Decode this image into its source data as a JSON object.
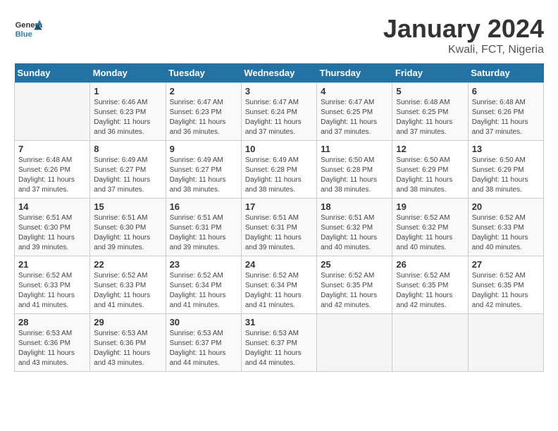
{
  "header": {
    "logo_general": "General",
    "logo_blue": "Blue",
    "month": "January 2024",
    "location": "Kwali, FCT, Nigeria"
  },
  "days_of_week": [
    "Sunday",
    "Monday",
    "Tuesday",
    "Wednesday",
    "Thursday",
    "Friday",
    "Saturday"
  ],
  "weeks": [
    [
      {
        "day": "",
        "info": ""
      },
      {
        "day": "1",
        "info": "Sunrise: 6:46 AM\nSunset: 6:23 PM\nDaylight: 11 hours\nand 36 minutes."
      },
      {
        "day": "2",
        "info": "Sunrise: 6:47 AM\nSunset: 6:23 PM\nDaylight: 11 hours\nand 36 minutes."
      },
      {
        "day": "3",
        "info": "Sunrise: 6:47 AM\nSunset: 6:24 PM\nDaylight: 11 hours\nand 37 minutes."
      },
      {
        "day": "4",
        "info": "Sunrise: 6:47 AM\nSunset: 6:25 PM\nDaylight: 11 hours\nand 37 minutes."
      },
      {
        "day": "5",
        "info": "Sunrise: 6:48 AM\nSunset: 6:25 PM\nDaylight: 11 hours\nand 37 minutes."
      },
      {
        "day": "6",
        "info": "Sunrise: 6:48 AM\nSunset: 6:26 PM\nDaylight: 11 hours\nand 37 minutes."
      }
    ],
    [
      {
        "day": "7",
        "info": "Sunrise: 6:48 AM\nSunset: 6:26 PM\nDaylight: 11 hours\nand 37 minutes."
      },
      {
        "day": "8",
        "info": "Sunrise: 6:49 AM\nSunset: 6:27 PM\nDaylight: 11 hours\nand 37 minutes."
      },
      {
        "day": "9",
        "info": "Sunrise: 6:49 AM\nSunset: 6:27 PM\nDaylight: 11 hours\nand 38 minutes."
      },
      {
        "day": "10",
        "info": "Sunrise: 6:49 AM\nSunset: 6:28 PM\nDaylight: 11 hours\nand 38 minutes."
      },
      {
        "day": "11",
        "info": "Sunrise: 6:50 AM\nSunset: 6:28 PM\nDaylight: 11 hours\nand 38 minutes."
      },
      {
        "day": "12",
        "info": "Sunrise: 6:50 AM\nSunset: 6:29 PM\nDaylight: 11 hours\nand 38 minutes."
      },
      {
        "day": "13",
        "info": "Sunrise: 6:50 AM\nSunset: 6:29 PM\nDaylight: 11 hours\nand 38 minutes."
      }
    ],
    [
      {
        "day": "14",
        "info": "Sunrise: 6:51 AM\nSunset: 6:30 PM\nDaylight: 11 hours\nand 39 minutes."
      },
      {
        "day": "15",
        "info": "Sunrise: 6:51 AM\nSunset: 6:30 PM\nDaylight: 11 hours\nand 39 minutes."
      },
      {
        "day": "16",
        "info": "Sunrise: 6:51 AM\nSunset: 6:31 PM\nDaylight: 11 hours\nand 39 minutes."
      },
      {
        "day": "17",
        "info": "Sunrise: 6:51 AM\nSunset: 6:31 PM\nDaylight: 11 hours\nand 39 minutes."
      },
      {
        "day": "18",
        "info": "Sunrise: 6:51 AM\nSunset: 6:32 PM\nDaylight: 11 hours\nand 40 minutes."
      },
      {
        "day": "19",
        "info": "Sunrise: 6:52 AM\nSunset: 6:32 PM\nDaylight: 11 hours\nand 40 minutes."
      },
      {
        "day": "20",
        "info": "Sunrise: 6:52 AM\nSunset: 6:33 PM\nDaylight: 11 hours\nand 40 minutes."
      }
    ],
    [
      {
        "day": "21",
        "info": "Sunrise: 6:52 AM\nSunset: 6:33 PM\nDaylight: 11 hours\nand 41 minutes."
      },
      {
        "day": "22",
        "info": "Sunrise: 6:52 AM\nSunset: 6:33 PM\nDaylight: 11 hours\nand 41 minutes."
      },
      {
        "day": "23",
        "info": "Sunrise: 6:52 AM\nSunset: 6:34 PM\nDaylight: 11 hours\nand 41 minutes."
      },
      {
        "day": "24",
        "info": "Sunrise: 6:52 AM\nSunset: 6:34 PM\nDaylight: 11 hours\nand 41 minutes."
      },
      {
        "day": "25",
        "info": "Sunrise: 6:52 AM\nSunset: 6:35 PM\nDaylight: 11 hours\nand 42 minutes."
      },
      {
        "day": "26",
        "info": "Sunrise: 6:52 AM\nSunset: 6:35 PM\nDaylight: 11 hours\nand 42 minutes."
      },
      {
        "day": "27",
        "info": "Sunrise: 6:52 AM\nSunset: 6:35 PM\nDaylight: 11 hours\nand 42 minutes."
      }
    ],
    [
      {
        "day": "28",
        "info": "Sunrise: 6:53 AM\nSunset: 6:36 PM\nDaylight: 11 hours\nand 43 minutes."
      },
      {
        "day": "29",
        "info": "Sunrise: 6:53 AM\nSunset: 6:36 PM\nDaylight: 11 hours\nand 43 minutes."
      },
      {
        "day": "30",
        "info": "Sunrise: 6:53 AM\nSunset: 6:37 PM\nDaylight: 11 hours\nand 44 minutes."
      },
      {
        "day": "31",
        "info": "Sunrise: 6:53 AM\nSunset: 6:37 PM\nDaylight: 11 hours\nand 44 minutes."
      },
      {
        "day": "",
        "info": ""
      },
      {
        "day": "",
        "info": ""
      },
      {
        "day": "",
        "info": ""
      }
    ]
  ]
}
